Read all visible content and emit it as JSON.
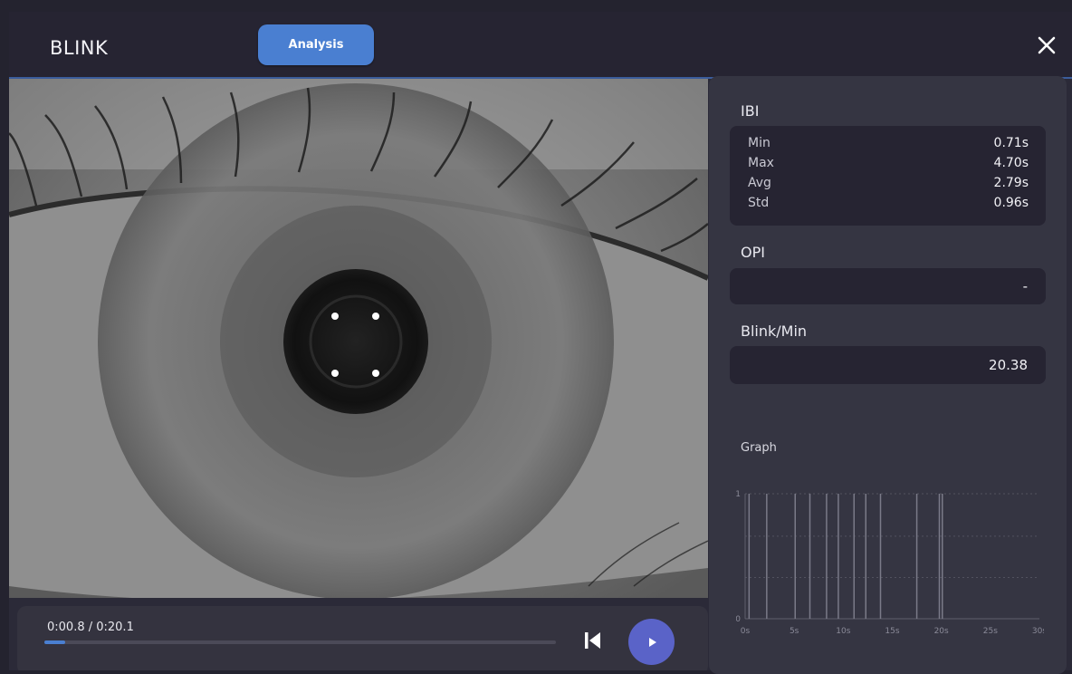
{
  "header": {
    "app_title": "BLINK",
    "tabs": [
      {
        "label": "Analysis",
        "active": true
      }
    ],
    "close_icon": "close-icon"
  },
  "colors": {
    "accent": "#4a7fd1",
    "play": "#5a63c8",
    "background": "#24232f",
    "panel": "#353542"
  },
  "player": {
    "time": "0:00.8 / 0:20.1",
    "progress": 0.04,
    "skip_icon": "skip-back-icon",
    "play_icon": "play-icon"
  },
  "stats": {
    "ibi": {
      "title": "IBI",
      "rows": [
        {
          "label": "Min",
          "value": "0.71s"
        },
        {
          "label": "Max",
          "value": "4.70s"
        },
        {
          "label": "Avg",
          "value": "2.79s"
        },
        {
          "label": "Std",
          "value": "0.96s"
        }
      ]
    },
    "opi": {
      "title": "OPI",
      "value": "-"
    },
    "blink_per_min": {
      "title": "Blink/Min",
      "value": "20.38"
    }
  },
  "graph_section": {
    "title": "Graph"
  },
  "chart_data": {
    "type": "bar",
    "title": "",
    "xlabel": "",
    "ylabel": "",
    "x_ticks": [
      "0s",
      "5s",
      "10s",
      "15s",
      "20s",
      "25s",
      "30s"
    ],
    "y_ticks": [
      "0",
      "1"
    ],
    "xlim": [
      0,
      30
    ],
    "ylim": [
      0,
      1
    ],
    "grid": true,
    "blink_times": [
      0.4,
      2.2,
      5.1,
      6.6,
      8.3,
      9.5,
      11.1,
      12.3,
      13.8,
      17.5,
      19.8,
      20.1
    ],
    "values": [
      1,
      1,
      1,
      1,
      1,
      1,
      1,
      1,
      1,
      1,
      1,
      1
    ]
  }
}
